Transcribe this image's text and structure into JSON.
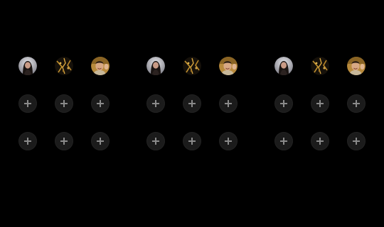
{
  "theme": {
    "background": "#000000",
    "add_button_fill": "#1b1b1b",
    "add_button_icon": "#8a8a8a"
  },
  "groups": [
    {
      "avatars": [
        {
          "label": "",
          "icon": "woman-long-hair-avatar"
        },
        {
          "label": "",
          "icon": "dark-gold-pattern-avatar"
        },
        {
          "label": "",
          "icon": "smiling-man-avatar"
        }
      ],
      "add_slots": 6,
      "add_icon": "plus-icon"
    },
    {
      "avatars": [
        {
          "label": "",
          "icon": "woman-long-hair-avatar"
        },
        {
          "label": "",
          "icon": "dark-gold-pattern-avatar"
        },
        {
          "label": "",
          "icon": "smiling-man-avatar"
        }
      ],
      "add_slots": 6,
      "add_icon": "plus-icon"
    },
    {
      "avatars": [
        {
          "label": "",
          "icon": "woman-long-hair-avatar"
        },
        {
          "label": "",
          "icon": "dark-gold-pattern-avatar"
        },
        {
          "label": "",
          "icon": "smiling-man-avatar"
        }
      ],
      "add_slots": 6,
      "add_icon": "plus-icon"
    }
  ]
}
